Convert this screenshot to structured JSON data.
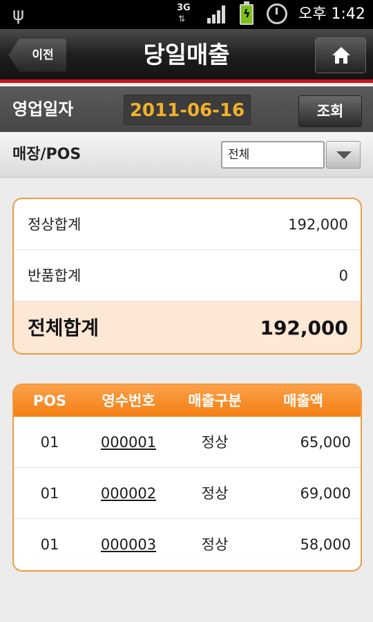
{
  "status_bar": {
    "network": "3G",
    "time": "오후 1:42"
  },
  "title_bar": {
    "back_label": "이전",
    "title": "당일매출",
    "home_icon": "home-icon"
  },
  "date_row": {
    "label": "영업일자",
    "value": "2011-06-16",
    "query_label": "조회"
  },
  "pos_row": {
    "label": "매장/POS",
    "selected": "전체"
  },
  "summary": {
    "normal_label": "정상합계",
    "normal_value": "192,000",
    "return_label": "반품합계",
    "return_value": "0",
    "total_label": "전체합계",
    "total_value": "192,000"
  },
  "table": {
    "headers": [
      "POS",
      "영수번호",
      "매출구분",
      "매출액"
    ],
    "rows": [
      {
        "pos": "01",
        "receipt": "000001",
        "type": "정상",
        "amount": "65,000"
      },
      {
        "pos": "01",
        "receipt": "000002",
        "type": "정상",
        "amount": "69,000"
      },
      {
        "pos": "01",
        "receipt": "000003",
        "type": "정상",
        "amount": "58,000"
      }
    ]
  },
  "colors": {
    "accent_orange": "#f47f13",
    "date_text": "#f1b12d",
    "title_bar_stripe": "#c8161d",
    "total_row_bg": "#fde8d6"
  }
}
